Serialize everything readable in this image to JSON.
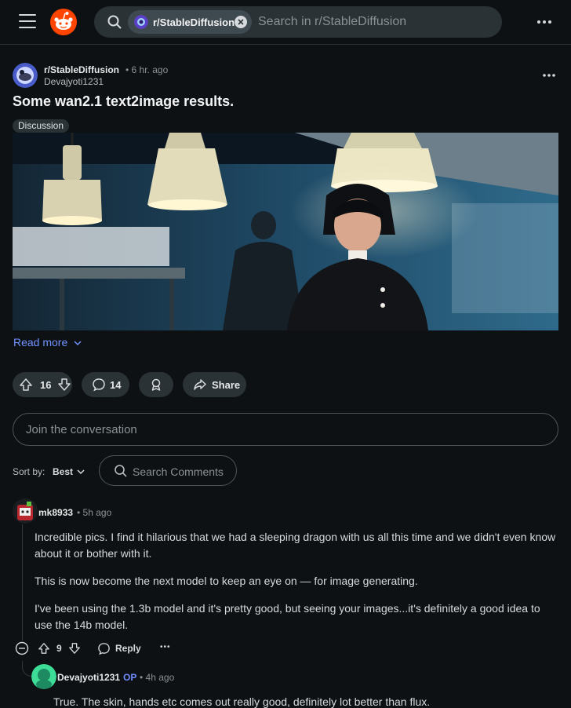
{
  "topbar": {
    "menu_icon": "hamburger-menu-icon",
    "logo_icon": "reddit-logo-icon",
    "search_chip_label": "r/StableDiffusion",
    "search_placeholder": "Search in r/StableDiffusion",
    "more_icon": "more-horizontal-icon"
  },
  "post": {
    "subreddit": "r/StableDiffusion",
    "time": "• 6 hr. ago",
    "author": "Devajyoti1231",
    "title": "Some wan2.1 text2image results.",
    "flair": "Discussion",
    "read_more": "Read more",
    "upvotes": "16",
    "comments": "14",
    "share_label": "Share"
  },
  "conversation": {
    "placeholder": "Join the conversation",
    "sort_label": "Sort by:",
    "sort_value": "Best",
    "search_comments": "Search Comments"
  },
  "comments": [
    {
      "user": "mk8933",
      "time": "• 5h ago",
      "paragraphs": [
        "Incredible pics. I find it hilarious that we had a sleeping dragon with us all this time and we didn't even know about it or bother with it.",
        "This is now become the next model to keep an eye on — for image generating.",
        "I've been using the 1.3b model and it's pretty good, but seeing your images...it's definitely a good idea to use the 14b model."
      ],
      "votes": "9",
      "reply_label": "Reply",
      "more_label": "•••"
    },
    {
      "user": "Devajyoti1231",
      "op_tag": "OP",
      "time": "• 4h ago",
      "body": "True. The skin, hands etc comes out really good, definitely lot better than flux."
    }
  ],
  "colors": {
    "background": "#0e1113",
    "pill": "#2a3236",
    "link": "#7193ff",
    "op": "#6e8dff"
  }
}
